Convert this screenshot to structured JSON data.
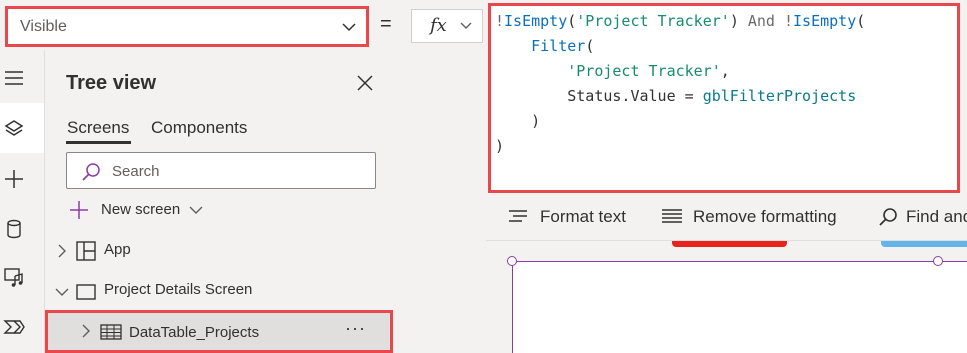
{
  "property_selector": {
    "value": "Visible"
  },
  "equals": "=",
  "fx_label": "fx",
  "formula": {
    "lines": [
      "!IsEmpty('Project Tracker') And !IsEmpty(",
      "    Filter(",
      "        'Project Tracker',",
      "        Status.Value = gblFilterProjects",
      "    )",
      ")"
    ]
  },
  "format_toolbar": {
    "format_text": "Format text",
    "remove_formatting": "Remove formatting",
    "find_and": "Find and"
  },
  "tree_view": {
    "title": "Tree view",
    "tabs": [
      "Screens",
      "Components"
    ],
    "active_tab": "Screens",
    "search_placeholder": "Search",
    "new_screen": "New screen",
    "items": [
      {
        "label": "App",
        "icon": "app-icon",
        "expanded": false
      },
      {
        "label": "Project Details Screen",
        "icon": "screen-icon",
        "expanded": true
      },
      {
        "label": "DataTable_Projects",
        "icon": "table-icon",
        "expanded": false,
        "selected": true
      }
    ],
    "more_label": "···"
  },
  "rail_icons": [
    "hamburger-icon",
    "layers-icon",
    "plus-icon",
    "database-icon",
    "media-icon",
    "power-automate-icon"
  ],
  "colors": {
    "highlight_border": "#e8474c",
    "selection": "#8a3ea3",
    "string": "#188c6e",
    "function": "#0a6fbd"
  }
}
